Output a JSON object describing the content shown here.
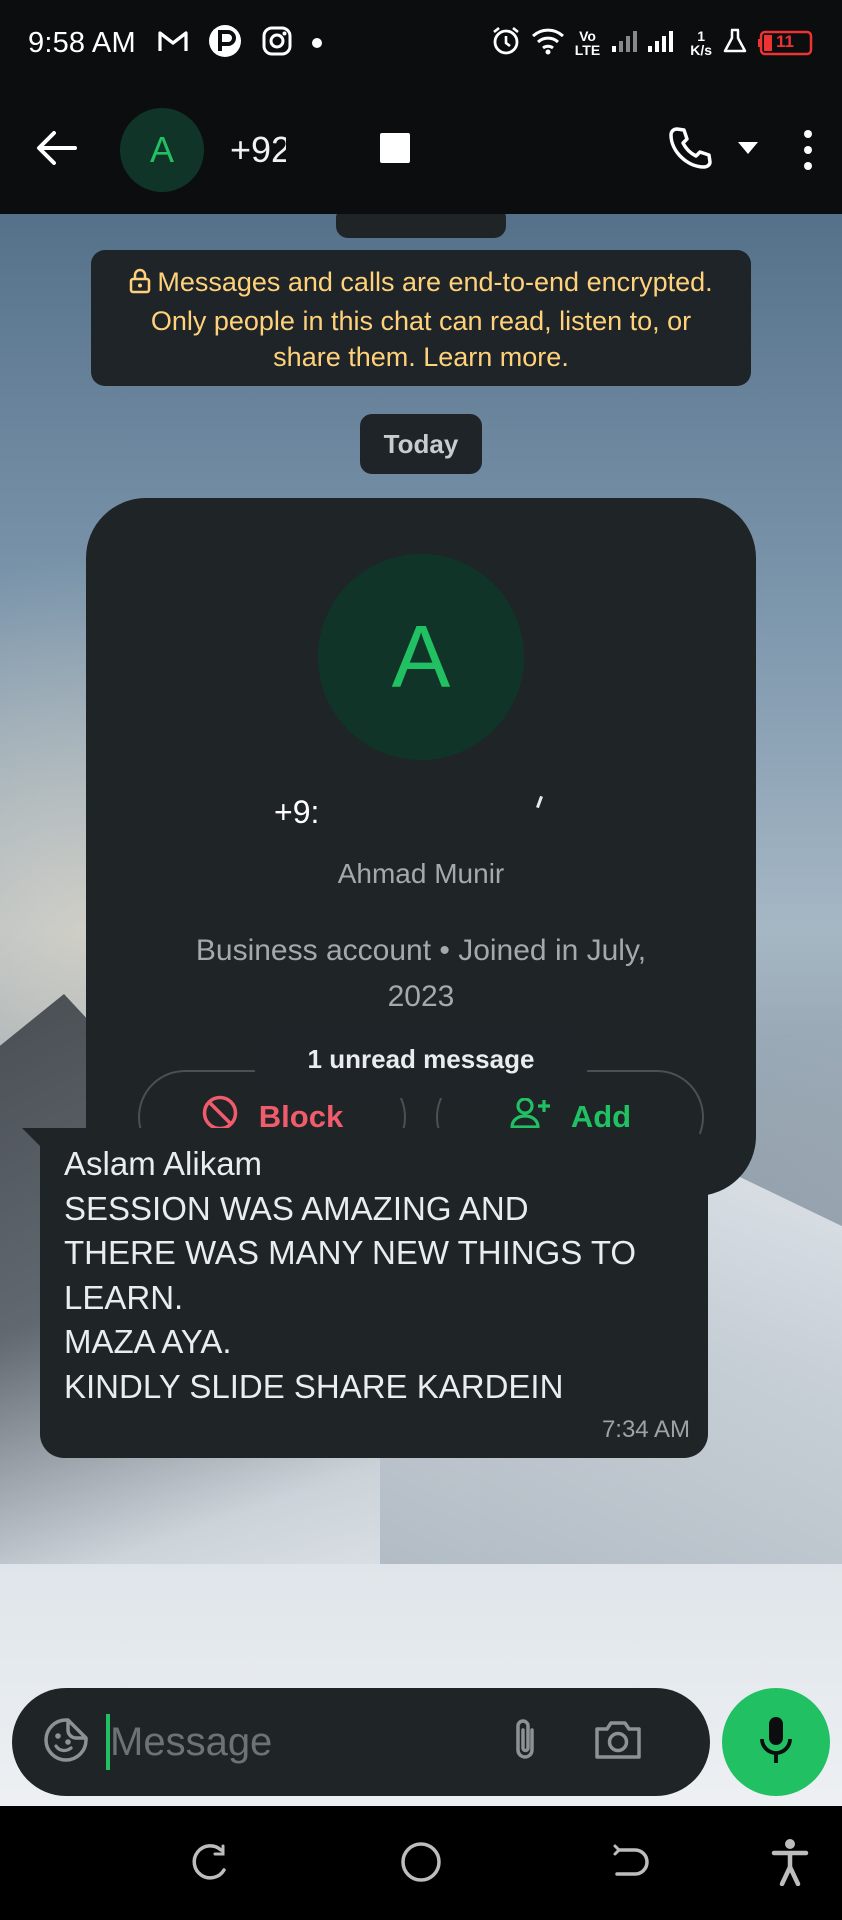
{
  "status_bar": {
    "time": "9:58 AM",
    "network_label_top": "Vo",
    "network_label_bottom": "LTE",
    "speed_value": "1",
    "speed_unit": "K/s",
    "battery_level": "11",
    "icons": [
      "gmail-icon",
      "p-app-icon",
      "instagram-icon",
      "alarm-icon",
      "wifi-icon",
      "signal-icon",
      "beaker-icon",
      "battery-icon"
    ]
  },
  "header": {
    "avatar_letter": "A",
    "contact_number": "+92",
    "icons": [
      "back-arrow-icon",
      "phone-icon",
      "caret-down-icon",
      "more-vert-icon"
    ]
  },
  "chat": {
    "encryption_notice": "Messages and calls are end-to-end encrypted. Only people in this chat can read, listen to, or share them. Learn more.",
    "date_label": "Today",
    "profile_card": {
      "avatar_letter": "A",
      "number": "+9:",
      "name": "Ahmad Munir",
      "meta": "Business account • Joined in July, 2023",
      "block_label": "Block",
      "add_label": "Add"
    },
    "unread_label": "1 unread message",
    "message": {
      "lines": [
        "Aslam Alikam",
        "SESSION WAS AMAZING AND",
        "THERE WAS MANY NEW THINGS TO",
        "LEARN.",
        "MAZA AYA.",
        "KINDLY SLIDE SHARE KARDEIN"
      ],
      "time": "7:34 AM"
    }
  },
  "composer": {
    "placeholder": "Message",
    "icons": [
      "sticker-icon",
      "paperclip-icon",
      "camera-icon",
      "microphone-icon"
    ]
  },
  "nav_bar": {
    "icons": [
      "recents-icon",
      "home-icon",
      "back-icon",
      "accessibility-icon"
    ]
  },
  "colors": {
    "accent_green": "#21c063",
    "avatar_bg": "#103528",
    "danger_red": "#f15c6d",
    "bubble_bg": "#1f2427",
    "notice_text": "#ffd27a"
  }
}
